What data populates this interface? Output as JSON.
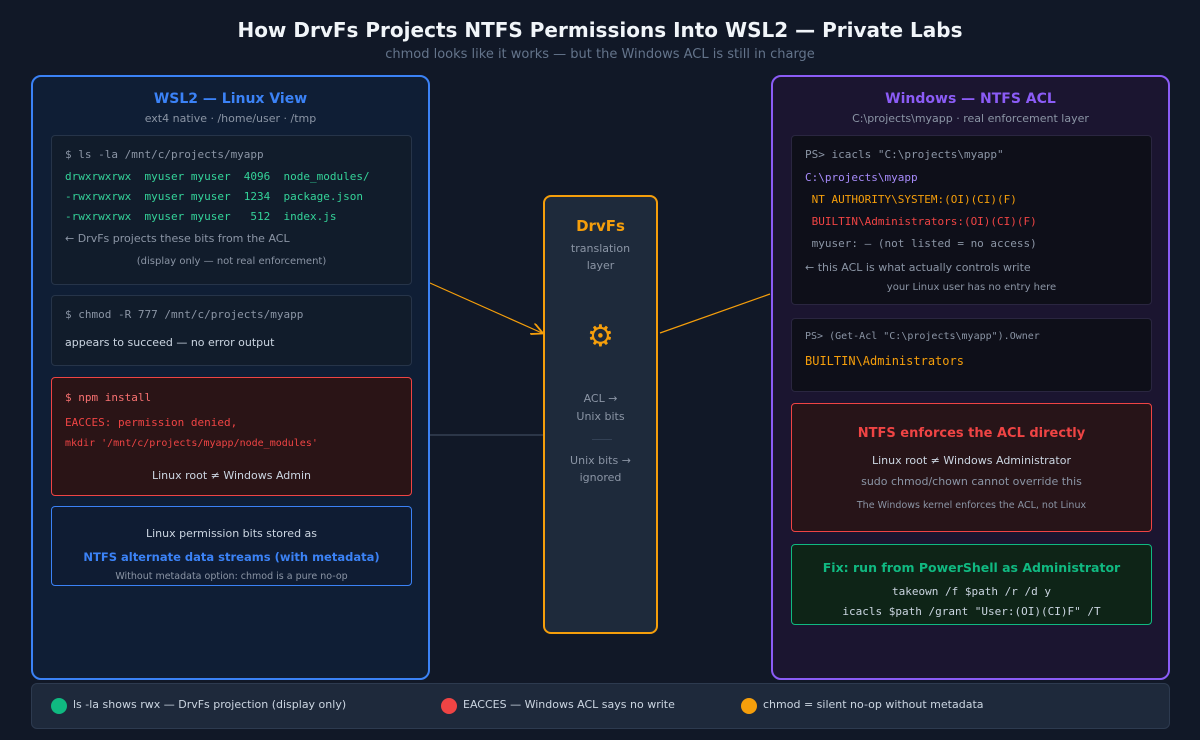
{
  "header": {
    "title": "How DrvFs Projects NTFS Permissions Into WSL2 — Private Labs",
    "subtitle": "chmod looks like it works — but the Windows ACL is still in charge"
  },
  "left": {
    "title": "WSL2 — Linux View",
    "subtitle": "ext4 native  ·  /home/user  ·  /tmp",
    "ls_card": {
      "command": "$ ls -la /mnt/c/projects/myapp",
      "rows": [
        "drwxrwxrwx  myuser myuser  4096  node_modules/",
        "-rwxrwxrwx  myuser myuser  1234  package.json",
        "-rwxrwxrwx  myuser myuser   512  index.js"
      ],
      "note": "← DrvFs projects these bits from the ACL",
      "note2": "(display only — not real enforcement)"
    },
    "chmod_card": {
      "command": "$ chmod -R 777 /mnt/c/projects/myapp",
      "note": "appears to succeed — no error output"
    },
    "npm_card": {
      "command": "$ npm install",
      "error1": "EACCES: permission denied,",
      "error2": "mkdir '/mnt/c/projects/myapp/node_modules'",
      "note": "Linux root ≠ Windows Admin"
    },
    "meta_card": {
      "line1": "Linux permission bits stored as",
      "line2": "NTFS alternate data streams (with metadata)",
      "line3": "Without metadata option: chmod is a pure no-op"
    }
  },
  "center": {
    "title": "DrvFs",
    "sub1": "translation",
    "sub2": "layer",
    "gear": "⚙",
    "map1a": "ACL →",
    "map1b": "Unix bits",
    "map2a": "Unix bits →",
    "map2b": "ignored"
  },
  "right": {
    "title": "Windows — NTFS ACL",
    "subtitle": "C:\\projects\\myapp  ·  real enforcement layer",
    "icacls_card": {
      "command": "PS> icacls \"C:\\projects\\myapp\"",
      "path": "C:\\projects\\myapp",
      "entry1": " NT AUTHORITY\\SYSTEM:(OI)(CI)(F)",
      "entry2": " BUILTIN\\Administrators:(OI)(CI)(F)",
      "entry3": " myuser: — (not listed = no access)",
      "note": "← this ACL is what actually controls write",
      "note2": "your Linux user has no entry here"
    },
    "owner_card": {
      "command": "PS> (Get-Acl \"C:\\projects\\myapp\").Owner",
      "result": "BUILTIN\\Administrators"
    },
    "enforce_card": {
      "title": "NTFS enforces the ACL directly",
      "line1": "Linux root ≠ Windows Administrator",
      "line2": "sudo chmod/chown cannot override this",
      "line3": "The Windows kernel enforces the ACL, not Linux"
    },
    "fix_card": {
      "title": "Fix: run from PowerShell as Administrator",
      "cmd1": "takeown /f $path /r /d y",
      "cmd2": "icacls $path /grant \"User:(OI)(CI)F\" /T"
    }
  },
  "legend": {
    "items": [
      {
        "label": "ls -la shows rwx — DrvFs projection (display only)",
        "color": "#10b981"
      },
      {
        "label": "EACCES — Windows ACL says no write",
        "color": "#ef4444"
      },
      {
        "label": "chmod = silent no-op without metadata",
        "color": "#f59e0b"
      }
    ]
  },
  "colors": {
    "linux": "#3b82f6",
    "windows": "#8b5cf6",
    "drvfs": "#f59e0b",
    "ok": "#10b981",
    "error": "#ef4444"
  }
}
